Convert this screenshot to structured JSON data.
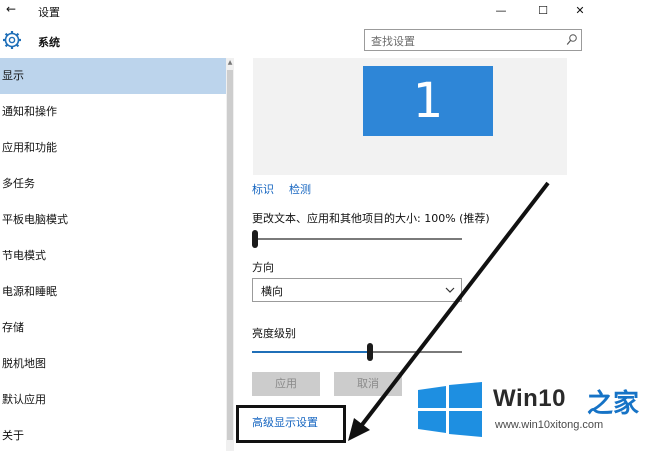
{
  "window": {
    "title": "设置",
    "back_icon": "←",
    "min_icon": "—",
    "max_icon": "☐",
    "close_icon": "✕"
  },
  "header": {
    "section_title": "系统",
    "search_placeholder": "查找设置"
  },
  "sidebar": {
    "items": [
      {
        "label": "显示",
        "active": true
      },
      {
        "label": "通知和操作"
      },
      {
        "label": "应用和功能"
      },
      {
        "label": "多任务"
      },
      {
        "label": "平板电脑模式"
      },
      {
        "label": "节电模式"
      },
      {
        "label": "电源和睡眠"
      },
      {
        "label": "存储"
      },
      {
        "label": "脱机地图"
      },
      {
        "label": "默认应用"
      },
      {
        "label": "关于"
      }
    ]
  },
  "display": {
    "monitor_number": "1",
    "identify_link": "标识",
    "detect_link": "检测",
    "scale_label": "更改文本、应用和其他项目的大小: 100% (推荐)",
    "scale_value": 0,
    "orientation_label": "方向",
    "orientation_value": "横向",
    "brightness_label": "亮度级别",
    "brightness_value": 0.56,
    "apply_button": "应用",
    "cancel_button": "取消",
    "advanced_link": "高级显示设置"
  },
  "watermark": {
    "brand": "Win10",
    "brand_zh": "之家",
    "url": "www.win10xitong.com"
  },
  "colors": {
    "accent": "#2e86d7",
    "active_nav": "#bcd4ec",
    "link": "#1565c0"
  }
}
